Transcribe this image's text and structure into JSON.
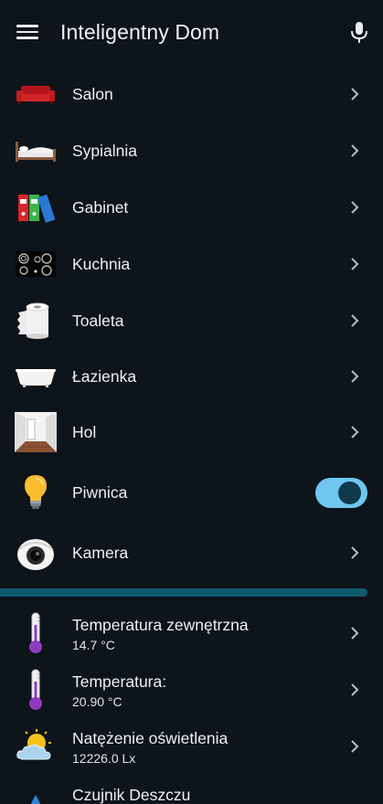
{
  "header": {
    "title": "Inteligentny Dom"
  },
  "rooms": [
    {
      "label": "Salon",
      "icon": "sofa-icon"
    },
    {
      "label": "Sypialnia",
      "icon": "bed-icon"
    },
    {
      "label": "Gabinet",
      "icon": "binders-icon"
    },
    {
      "label": "Kuchnia",
      "icon": "stove-icon"
    },
    {
      "label": "Toaleta",
      "icon": "toilet-paper-icon"
    },
    {
      "label": "Łazienka",
      "icon": "bathtub-icon"
    },
    {
      "label": "Hol",
      "icon": "hallway-icon"
    },
    {
      "label": "Piwnica",
      "icon": "lightbulb-icon",
      "toggle": true
    },
    {
      "label": "Kamera",
      "icon": "camera-icon"
    }
  ],
  "sensors": [
    {
      "label": "Temperatura zewnętrzna",
      "value": "14.7 °C",
      "icon": "thermometer-icon"
    },
    {
      "label": "Temperatura:",
      "value": "20.90 °C",
      "icon": "thermometer-icon"
    },
    {
      "label": "Natężenie oświetlenia",
      "value": "12226.0 Lx",
      "icon": "sun-cloud-icon"
    },
    {
      "label": "Czujnik Deszczu",
      "icon": "rain-icon"
    }
  ],
  "colors": {
    "background": "#0d141a",
    "accent": "#6fc6f0",
    "divider": "#0f5a73"
  }
}
